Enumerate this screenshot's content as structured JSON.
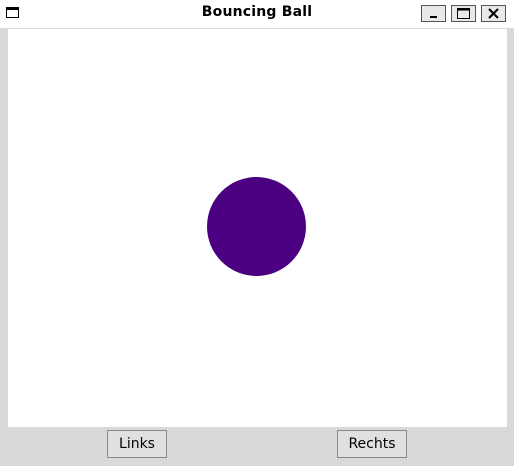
{
  "window": {
    "title": "Bouncing Ball"
  },
  "ball": {
    "color": "#4b0082"
  },
  "buttons": {
    "left_label": "Links",
    "right_label": "Rechts"
  }
}
